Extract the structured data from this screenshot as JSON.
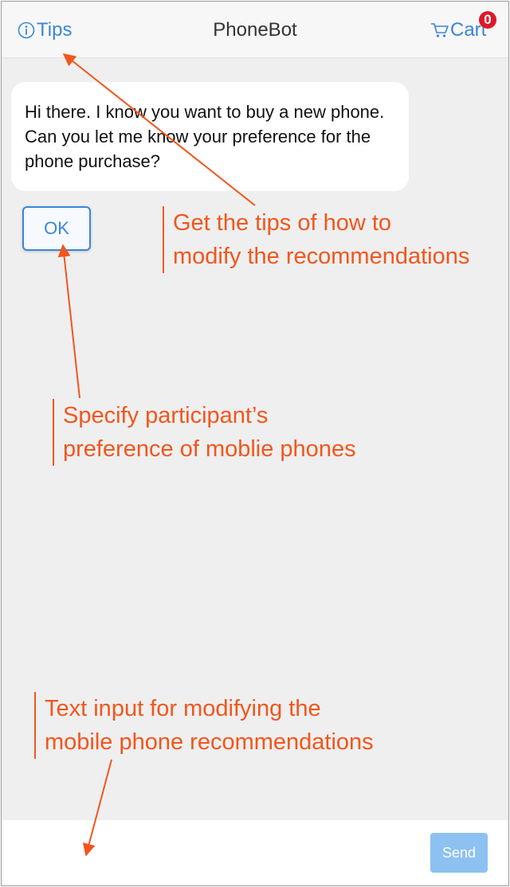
{
  "header": {
    "tips_label": "Tips",
    "title": "PhoneBot",
    "cart_label": "Cart",
    "cart_count": "0"
  },
  "chat": {
    "bot_message": "Hi there. I know you want to buy a new phone. Can you let me know your preference for the phone purchase?",
    "ok_label": "OK"
  },
  "annotations": {
    "tips": "Get the tips of how to\nmodify the recommendations",
    "preference": "Specify participant’s\npreference of moblie phones",
    "text_input": "Text input for modifying the\nmobile phone recommendations"
  },
  "input": {
    "placeholder": "",
    "send_label": "Send"
  },
  "colors": {
    "accent": "#3a87d6",
    "annotation": "#f2561d",
    "badge": "#e0162b",
    "send_disabled": "#8cc1f1",
    "background": "#efefef"
  },
  "icons": {
    "tips": "info-circle-icon",
    "cart": "shopping-cart-icon"
  }
}
